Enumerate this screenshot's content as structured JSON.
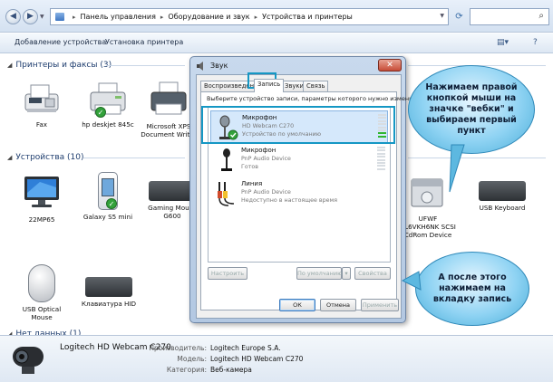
{
  "explorer": {
    "breadcrumb": [
      "Панель управления",
      "Оборудование и звук",
      "Устройства и принтеры"
    ],
    "toolbar": {
      "add_device": "Добавление устройства",
      "add_printer": "Установка принтера"
    },
    "groups": {
      "printers": "Принтеры и факсы (3)",
      "devices": "Устройства (10)",
      "unspecified": "Нет данных (1)"
    },
    "printers": [
      {
        "label": "Fax",
        "icon": "fax-icon"
      },
      {
        "label": "hp deskjet 845c",
        "icon": "printer-icon",
        "default": true
      },
      {
        "label": "Microsoft XPS\nDocument Writer",
        "icon": "printer-icon"
      }
    ],
    "devices_left": [
      {
        "label": "22MP65",
        "icon": "monitor-icon"
      },
      {
        "label": "Galaxy S5 mini",
        "icon": "phone-icon"
      },
      {
        "label": "Gaming Mouse\nG600",
        "icon": "keyboard-icon"
      }
    ],
    "devices_right": [
      {
        "label": "UFWF\nCL6VKH6NK SCSI\nCdRom Device",
        "icon": "cdrom-icon"
      },
      {
        "label": "USB Keyboard",
        "icon": "keyboard-icon"
      }
    ],
    "devices_bottom": [
      {
        "label": "USB Optical\nMouse",
        "icon": "mouse-icon"
      },
      {
        "label": "Клавиатура HID",
        "icon": "keyboard-icon"
      }
    ],
    "details": {
      "title": "Logitech HD Webcam C270",
      "manufacturer_label": "Производитель:",
      "manufacturer": "Logitech Europe S.A.",
      "model_label": "Модель:",
      "model": "Logitech HD Webcam C270",
      "category_label": "Категория:",
      "category": "Веб-камера"
    }
  },
  "dialog": {
    "title": "Звук",
    "tabs": [
      "Воспроизведение",
      "Запись",
      "Звуки",
      "Связь"
    ],
    "active_tab": "Запись",
    "instruction": "Выберите устройство записи, параметры которого нужно изменить:",
    "devices": [
      {
        "name": "Микрофон",
        "desc": "HD Webcam C270",
        "status": "Устройство по умолчанию",
        "default": true,
        "level": 0.3
      },
      {
        "name": "Микрофон",
        "desc": "PnP Audio Device",
        "status": "Готов",
        "default": false,
        "level": 0
      },
      {
        "name": "Линия",
        "desc": "PnP Audio Device",
        "status": "Недоступно в настоящее время",
        "default": false,
        "level": 0
      }
    ],
    "buttons": {
      "configure": "Настроить",
      "set_default": "По умолчанию",
      "properties": "Свойства",
      "ok": "ОК",
      "cancel": "Отмена",
      "apply": "Применить"
    }
  },
  "annotations": {
    "bubble_top": "Нажимаем правой кнопкой мыши на значке \"вебки\" и выбираем первый пункт",
    "bubble_bottom": "А после этого нажимаем на вкладку запись",
    "highlight_color": "#1597c4"
  }
}
